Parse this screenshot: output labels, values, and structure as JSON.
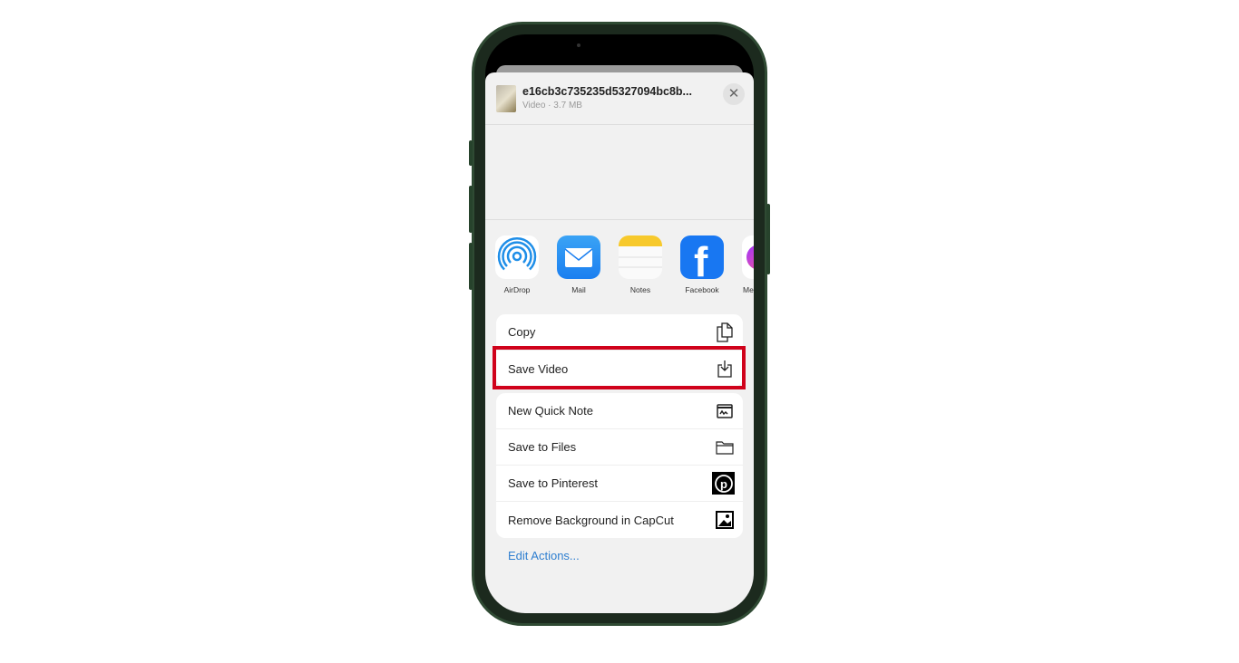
{
  "file": {
    "name": "e16cb3c735235d5327094bc8b...",
    "meta": "Video · 3.7 MB",
    "close_icon": "close-icon"
  },
  "apps": [
    {
      "label": "AirDrop",
      "icon": "airdrop-icon"
    },
    {
      "label": "Mail",
      "icon": "mail-icon"
    },
    {
      "label": "Notes",
      "icon": "notes-icon"
    },
    {
      "label": "Facebook",
      "icon": "facebook-icon"
    },
    {
      "label": "Me",
      "icon": "messenger-icon"
    }
  ],
  "actions_group1": [
    {
      "label": "Copy",
      "icon": "copy-icon"
    },
    {
      "label": "Save Video",
      "icon": "save-download-icon"
    }
  ],
  "actions_group2": [
    {
      "label": "New Quick Note",
      "icon": "quick-note-icon"
    },
    {
      "label": "Save to Files",
      "icon": "folder-icon"
    },
    {
      "label": "Save to Pinterest",
      "icon": "pinterest-icon"
    },
    {
      "label": "Remove Background in CapCut",
      "icon": "capcut-image-icon"
    }
  ],
  "edit_actions": "Edit Actions...",
  "colors": {
    "highlight": "#d0021b",
    "link": "#2f7fd0",
    "facebook": "#1877f2",
    "mail": "#2a8ff0"
  }
}
